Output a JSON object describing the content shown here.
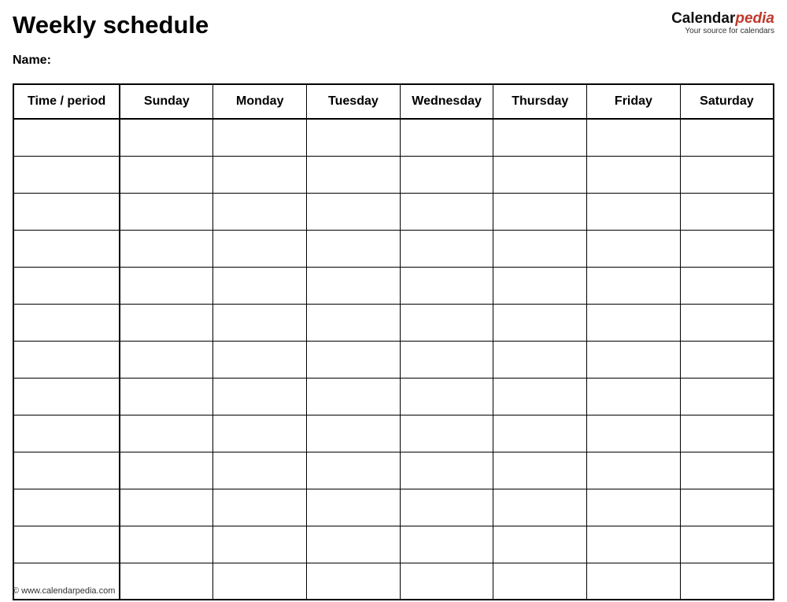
{
  "title": "Weekly schedule",
  "brand": {
    "part1": "Calendar",
    "part2": "pedia",
    "tagline": "Your source for calendars"
  },
  "name_label": "Name:",
  "columns": [
    "Time / period",
    "Sunday",
    "Monday",
    "Tuesday",
    "Wednesday",
    "Thursday",
    "Friday",
    "Saturday"
  ],
  "row_count": 13,
  "footer": "© www.calendarpedia.com"
}
